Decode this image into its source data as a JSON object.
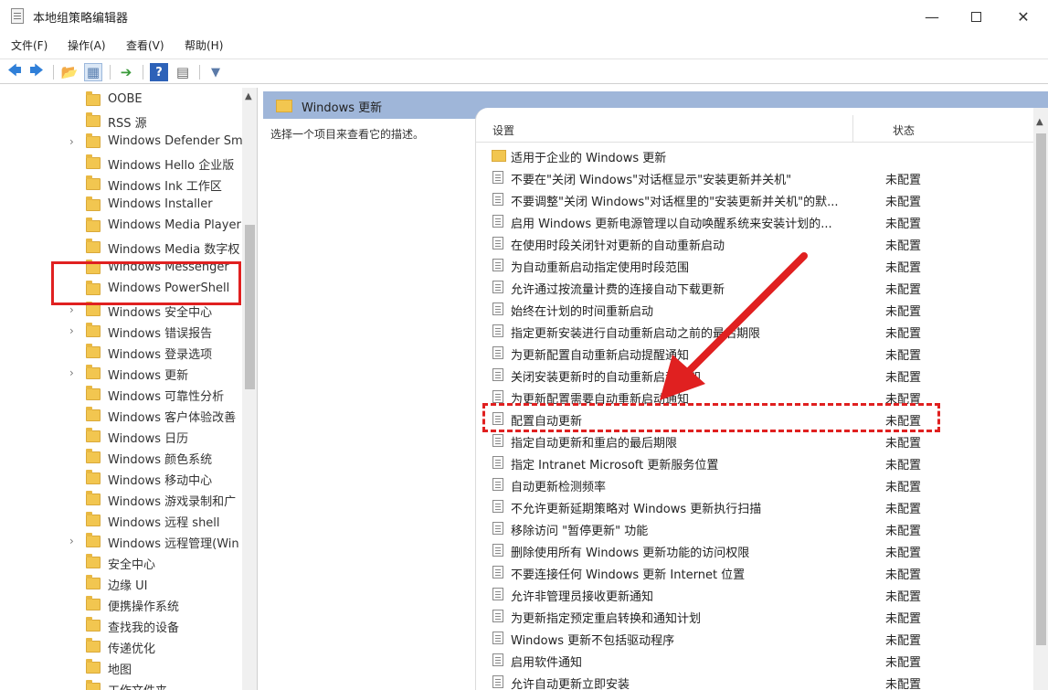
{
  "window": {
    "title": "本地组策略编辑器",
    "minimize": "—",
    "close": "✕"
  },
  "menu": [
    "文件(F)",
    "操作(A)",
    "查看(V)",
    "帮助(H)"
  ],
  "toolbar": {
    "back": "🡄",
    "forward": "🡆",
    "up": "📂",
    "show_tree": "▦",
    "export": "➔",
    "help": "?",
    "properties": "▤",
    "filter": "▼"
  },
  "tree": {
    "items": [
      {
        "label": "OOBE",
        "expandable": false
      },
      {
        "label": "RSS 源",
        "expandable": false
      },
      {
        "label": "Windows Defender Sm",
        "expandable": true
      },
      {
        "label": "Windows Hello 企业版",
        "expandable": false
      },
      {
        "label": "Windows Ink 工作区",
        "expandable": false
      },
      {
        "label": "Windows Installer",
        "expandable": false
      },
      {
        "label": "Windows Media Player",
        "expandable": false
      },
      {
        "label": "Windows Media 数字权",
        "expandable": false
      },
      {
        "label": "Windows Messenger",
        "expandable": false
      },
      {
        "label": "Windows PowerShell",
        "expandable": false
      },
      {
        "label": "Windows 安全中心",
        "expandable": true
      },
      {
        "label": "Windows 错误报告",
        "expandable": true
      },
      {
        "label": "Windows 登录选项",
        "expandable": false
      },
      {
        "label": "Windows 更新",
        "expandable": true
      },
      {
        "label": "Windows 可靠性分析",
        "expandable": false
      },
      {
        "label": "Windows 客户体验改善",
        "expandable": false
      },
      {
        "label": "Windows 日历",
        "expandable": false
      },
      {
        "label": "Windows 颜色系统",
        "expandable": false
      },
      {
        "label": "Windows 移动中心",
        "expandable": false
      },
      {
        "label": "Windows 游戏录制和广",
        "expandable": false
      },
      {
        "label": "Windows 远程 shell",
        "expandable": false
      },
      {
        "label": "Windows 远程管理(Win",
        "expandable": true
      },
      {
        "label": "安全中心",
        "expandable": false
      },
      {
        "label": "边缘 UI",
        "expandable": false
      },
      {
        "label": "便携操作系统",
        "expandable": false
      },
      {
        "label": "查找我的设备",
        "expandable": false
      },
      {
        "label": "传递优化",
        "expandable": false
      },
      {
        "label": "地图",
        "expandable": false
      },
      {
        "label": "工作文件夹",
        "expandable": false
      }
    ]
  },
  "pane": {
    "title": "Windows 更新",
    "description": "选择一个项目来查看它的描述。",
    "col_setting": "设置",
    "col_status": "状态",
    "rows": [
      {
        "setting": "适用于企业的 Windows 更新",
        "status": "",
        "type": "folder"
      },
      {
        "setting": "不要在\"关闭 Windows\"对话框显示\"安装更新并关机\"",
        "status": "未配置",
        "type": "policy"
      },
      {
        "setting": "不要调整\"关闭 Windows\"对话框里的\"安装更新并关机\"的默...",
        "status": "未配置",
        "type": "policy"
      },
      {
        "setting": "启用 Windows 更新电源管理以自动唤醒系统来安装计划的...",
        "status": "未配置",
        "type": "policy"
      },
      {
        "setting": "在使用时段关闭针对更新的自动重新启动",
        "status": "未配置",
        "type": "policy"
      },
      {
        "setting": "为自动重新启动指定使用时段范围",
        "status": "未配置",
        "type": "policy"
      },
      {
        "setting": "允许通过按流量计费的连接自动下载更新",
        "status": "未配置",
        "type": "policy"
      },
      {
        "setting": "始终在计划的时间重新启动",
        "status": "未配置",
        "type": "policy"
      },
      {
        "setting": "指定更新安装进行自动重新启动之前的最后期限",
        "status": "未配置",
        "type": "policy"
      },
      {
        "setting": "为更新配置自动重新启动提醒通知",
        "status": "未配置",
        "type": "policy"
      },
      {
        "setting": "关闭安装更新时的自动重新启动通知",
        "status": "未配置",
        "type": "policy"
      },
      {
        "setting": "为更新配置需要自动重新启动通知",
        "status": "未配置",
        "type": "policy"
      },
      {
        "setting": "配置自动更新",
        "status": "未配置",
        "type": "policy"
      },
      {
        "setting": "指定自动更新和重启的最后期限",
        "status": "未配置",
        "type": "policy"
      },
      {
        "setting": "指定 Intranet Microsoft 更新服务位置",
        "status": "未配置",
        "type": "policy"
      },
      {
        "setting": "自动更新检测频率",
        "status": "未配置",
        "type": "policy"
      },
      {
        "setting": "不允许更新延期策略对 Windows 更新执行扫描",
        "status": "未配置",
        "type": "policy"
      },
      {
        "setting": "移除访问 \"暂停更新\" 功能",
        "status": "未配置",
        "type": "policy"
      },
      {
        "setting": "删除使用所有 Windows 更新功能的访问权限",
        "status": "未配置",
        "type": "policy"
      },
      {
        "setting": "不要连接任何 Windows 更新 Internet 位置",
        "status": "未配置",
        "type": "policy"
      },
      {
        "setting": "允许非管理员接收更新通知",
        "status": "未配置",
        "type": "policy"
      },
      {
        "setting": "为更新指定预定重启转换和通知计划",
        "status": "未配置",
        "type": "policy"
      },
      {
        "setting": "Windows 更新不包括驱动程序",
        "status": "未配置",
        "type": "policy"
      },
      {
        "setting": "启用软件通知",
        "status": "未配置",
        "type": "policy"
      },
      {
        "setting": "允许自动更新立即安装",
        "status": "未配置",
        "type": "policy"
      }
    ]
  },
  "colors": {
    "pane_header": "#9fb6d9",
    "highlight": "#e02020",
    "folder": "#f2c650"
  }
}
